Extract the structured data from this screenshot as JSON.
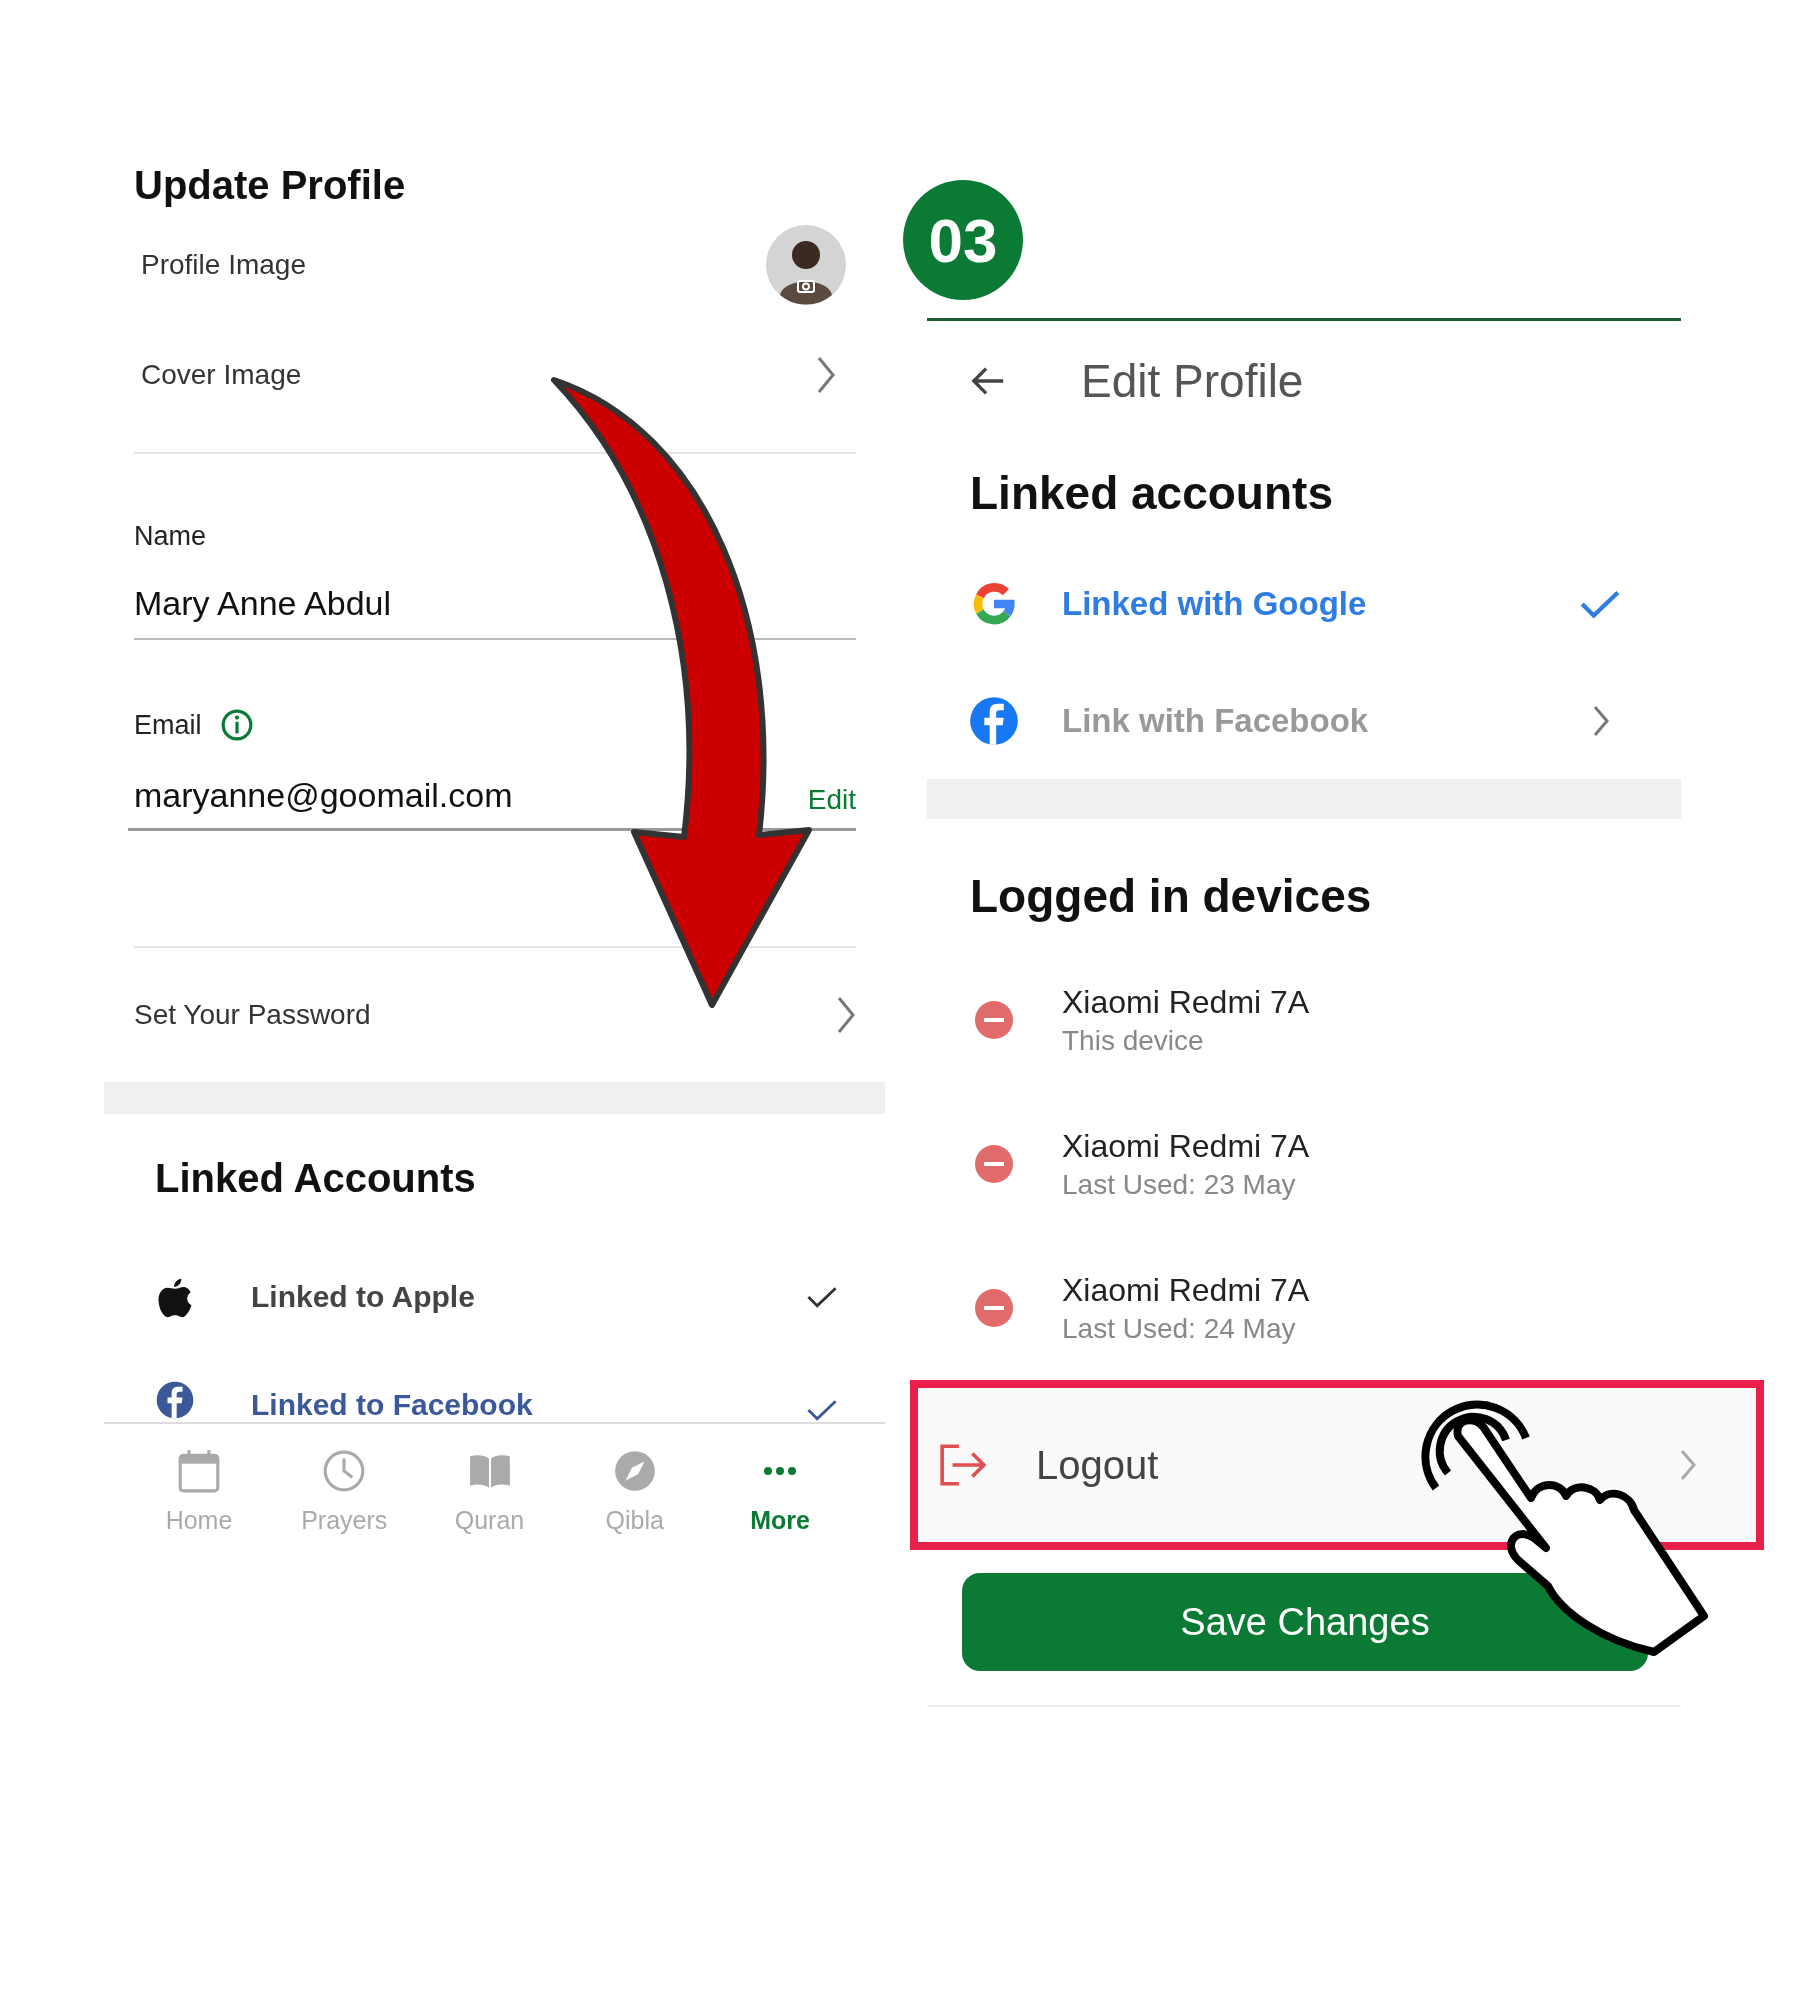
{
  "left_screen": {
    "title": "Update Profile",
    "image_rows": [
      {
        "kind": "avatar",
        "label": "Profile Image"
      },
      {
        "kind": "link",
        "label": "Cover Image"
      }
    ],
    "name_field": {
      "label": "Name",
      "value": "Mary Anne Abdul"
    },
    "email_field": {
      "label": "Email",
      "value": "maryanne@goomail.com",
      "action": "Edit"
    },
    "password_row": {
      "label": "Set Your Password"
    },
    "linked_accounts": {
      "title": "Linked Accounts",
      "items": [
        {
          "kind": "apple",
          "label": "Linked to Apple",
          "linked": true
        },
        {
          "kind": "facebook",
          "label": "Linked to Facebook",
          "linked": true
        }
      ]
    },
    "bottom_nav": [
      {
        "kind": "home",
        "label": "Home",
        "selected": false
      },
      {
        "kind": "prayers",
        "label": "Prayers",
        "selected": false
      },
      {
        "kind": "quran",
        "label": "Quran",
        "selected": false
      },
      {
        "kind": "qibla",
        "label": "Qibla",
        "selected": false
      },
      {
        "kind": "more",
        "label": "More",
        "selected": true
      }
    ]
  },
  "step": "03",
  "right_screen": {
    "title": "Edit Profile",
    "linked_accounts": {
      "title": "Linked accounts",
      "items": [
        {
          "kind": "google",
          "label": "Linked with Google",
          "linked": true
        },
        {
          "kind": "facebook",
          "label": "Link with Facebook",
          "linked": false
        }
      ]
    },
    "devices": {
      "title": "Logged in devices",
      "items": [
        {
          "name": "Xiaomi Redmi 7A",
          "detail": "This device"
        },
        {
          "name": "Xiaomi Redmi 7A",
          "detail": "Last Used: 23 May"
        },
        {
          "name": "Xiaomi Redmi 7A",
          "detail": "Last Used: 24 May"
        }
      ]
    },
    "logout": {
      "label": "Logout",
      "highlighted": true
    },
    "save_button": "Save Changes"
  }
}
